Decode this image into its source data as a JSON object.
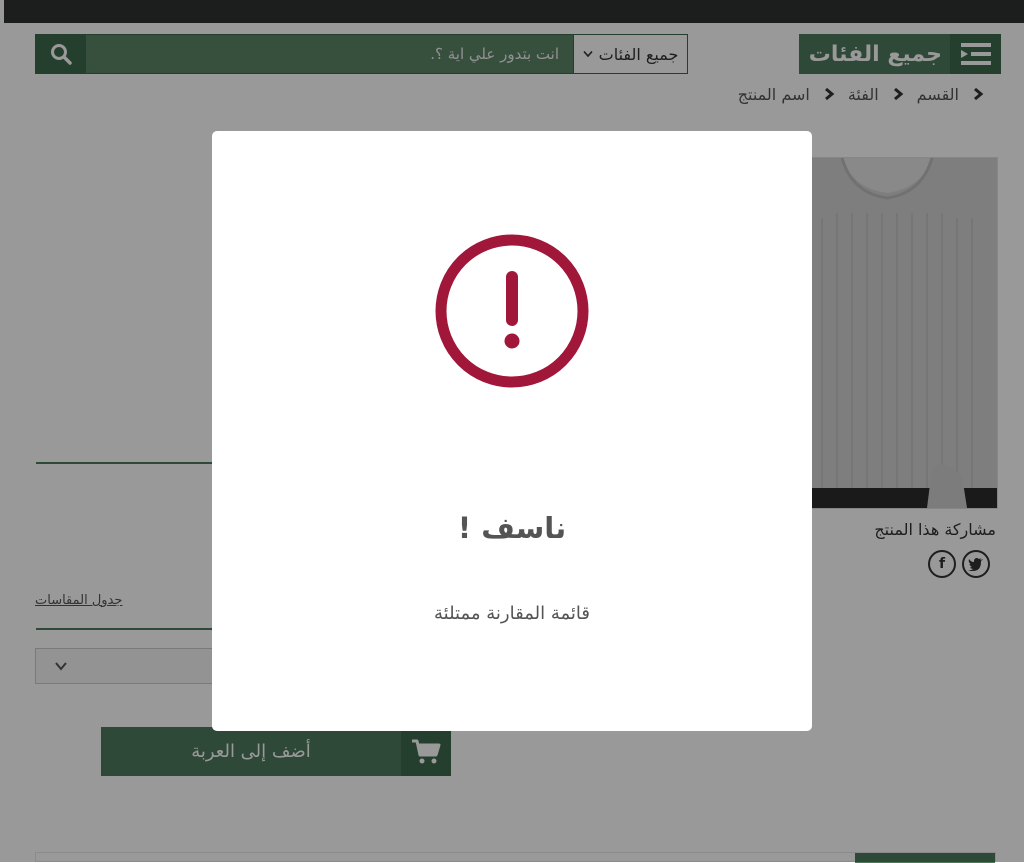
{
  "header": {
    "all_categories_label": "جميع الفئات",
    "search": {
      "placeholder": "انت بتدور علي اية ؟.",
      "category_select_value": "جميع الفئات"
    }
  },
  "breadcrumb": {
    "items": [
      "القسم",
      "الفئة",
      "اسم المنتج"
    ]
  },
  "product": {
    "share_label": "مشاركة هذا المنتج",
    "social": [
      "twitter-icon",
      "facebook-icon"
    ],
    "size_chart_link": "جدول المقاسات",
    "add_to_cart_label": "أضف إلى العربة"
  },
  "modal": {
    "title": "ناسف !",
    "message": "قائمة المقارنة ممتلئة",
    "icon": "exclamation-circle-icon",
    "icon_color": "#a0173a"
  },
  "colors": {
    "brand_green": "#4e7a5c",
    "brand_green_dark": "#3f6a4d",
    "topbar": "#2f3233",
    "alert": "#a0173a"
  }
}
